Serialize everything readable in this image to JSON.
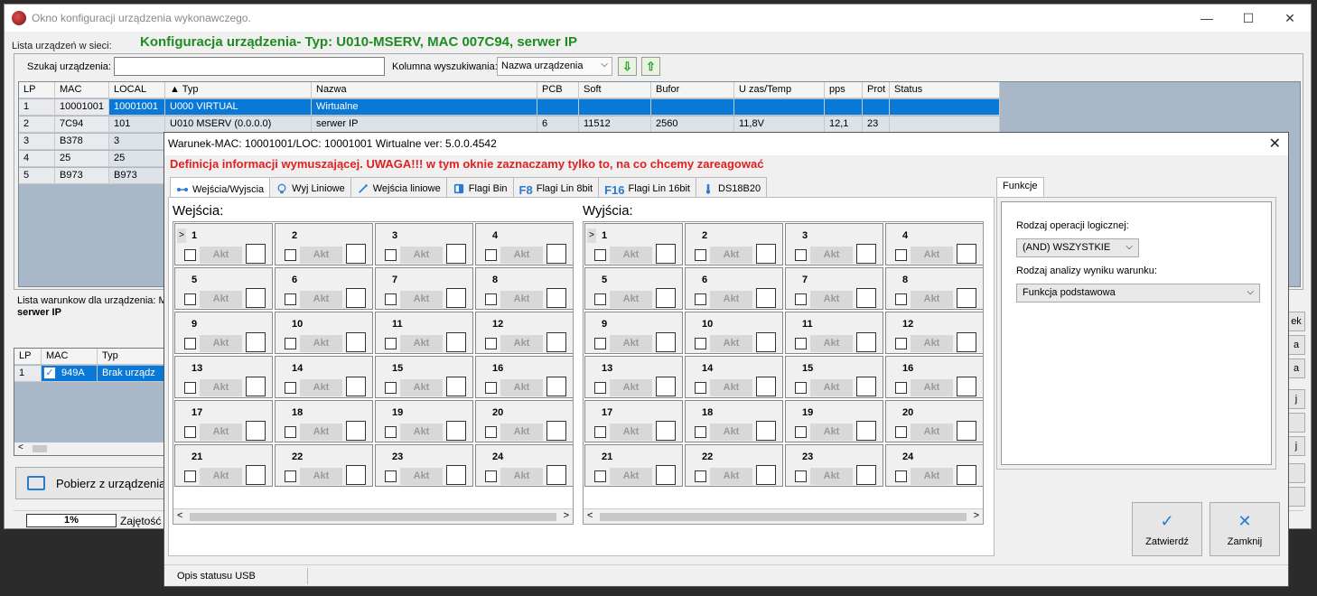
{
  "main_window": {
    "title": "Okno konfiguracji urządzenia wykonawczego.",
    "minimize": "—",
    "maximize": "☐",
    "close": "✕"
  },
  "header": {
    "devices_label": "Lista urządzeń w sieci:",
    "config_title": "Konfiguracja urządzenia- Typ: U010-MSERV, MAC 007C94, serwer IP"
  },
  "search": {
    "label": "Szukaj urządzenia:",
    "value": "",
    "column_label": "Kolumna wyszukiwania:",
    "column_value": "Nazwa urządzenia",
    "down_arrow": "⇩",
    "up_arrow": "⇧"
  },
  "device_table": {
    "columns": [
      "LP",
      "MAC",
      "LOCAL",
      "▲ Typ",
      "Nazwa",
      "PCB",
      "Soft",
      "Bufor",
      "U zas/Temp",
      "pps",
      "Prot",
      "Status"
    ],
    "rows": [
      [
        "1",
        "10001001",
        "10001001",
        "U000 VIRTUAL",
        "Wirtualne",
        "",
        "",
        "",
        "",
        "",
        "",
        ""
      ],
      [
        "2",
        "7C94",
        "101",
        "U010 MSERV (0.0.0.0)",
        "serwer IP",
        "6",
        "11512",
        "2560",
        "11,8V",
        "12,1",
        "23",
        ""
      ],
      [
        "3",
        "B378",
        "3",
        "",
        "",
        "",
        "",
        "",
        "",
        "",
        "",
        ""
      ],
      [
        "4",
        "25",
        "25",
        "",
        "",
        "",
        "",
        "",
        "",
        "",
        "",
        ""
      ],
      [
        "5",
        "B973",
        "B973",
        "",
        "",
        "",
        "",
        "",
        "",
        "",
        "",
        ""
      ]
    ]
  },
  "conditions": {
    "label": "Lista warunkow dla urządzenia: M",
    "device": "serwer IP",
    "columns": [
      "LP",
      "MAC",
      "Typ"
    ],
    "rows": [
      [
        "1",
        "949A",
        "Brak urządz"
      ]
    ],
    "check_mark": "✓"
  },
  "fetch_button": "Pobierz z urządzenia",
  "status": {
    "progress": "1%",
    "occupancy_label": "Zajętość"
  },
  "right_buttons": [
    "ek",
    "a",
    "a",
    "j",
    "",
    "j",
    "",
    ""
  ],
  "dialog": {
    "title": "Warunek-MAC: 10001001/LOC: 10001001 Wirtualne ver: 5.0.0.4542",
    "close": "✕",
    "warning": "Definicja informacji wymuszającej. UWAGA!!! w tym oknie zaznaczamy tylko to, na co chcemy zareagować",
    "tabs": [
      "Wejścia/Wyjscia",
      "Wyj Liniowe",
      "Wejścia liniowe",
      "Flagi Bin",
      "Flagi Lin 8bit",
      "Flagi Lin 16bit",
      "DS18B20"
    ],
    "tab_icons": [
      "io-icon",
      "bulb-icon",
      "wand-icon",
      "flag-bin-icon",
      "f8-icon",
      "f16-icon",
      "thermometer-icon"
    ],
    "inputs_title": "Wejścia:",
    "outputs_title": "Wyjścia:",
    "akt_label": "Akt",
    "row_marker": ">",
    "scroll_left": "<",
    "scroll_right": ">",
    "functions_tab": "Funkcje",
    "logic_label": "Rodzaj operacji logicznej:",
    "logic_value": "(AND) WSZYSTKIE",
    "analysis_label": "Rodzaj analizy wyniku warunku:",
    "analysis_value": "Funkcja podstawowa",
    "dropdown_arrow": "⌵",
    "confirm": "Zatwierdź",
    "confirm_icon": "✓",
    "cancel": "Zamknij",
    "cancel_icon": "✕",
    "status_text": "Opis statusu USB"
  },
  "colors": {
    "title_green": "#1e8c1e",
    "warning_red": "#e02020",
    "selection_blue": "#0a78d7"
  }
}
